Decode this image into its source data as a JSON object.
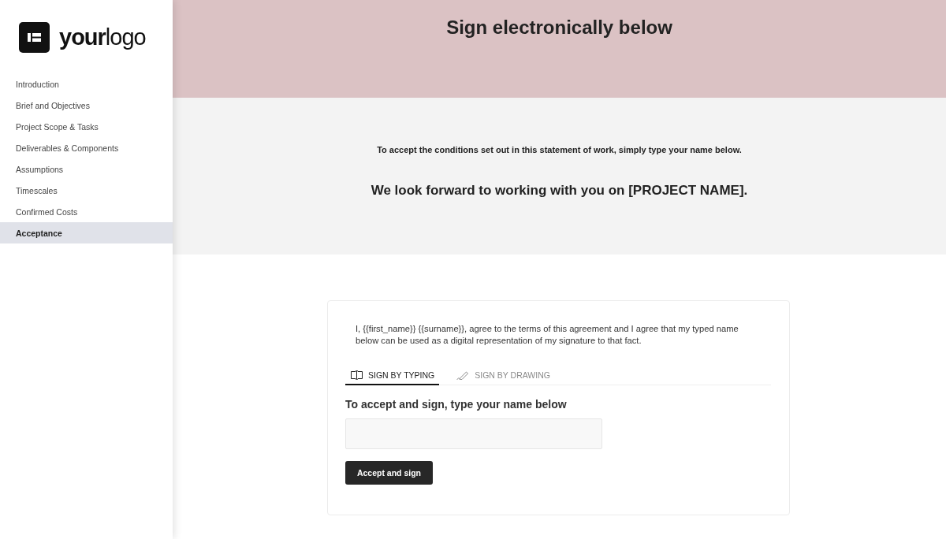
{
  "sidebar": {
    "logo": "**your**logo",
    "items": [
      {
        "label": "Introduction",
        "selected": false
      },
      {
        "label": "Brief and Objectives",
        "selected": false
      },
      {
        "label": "Project Scope & Tasks",
        "selected": false
      },
      {
        "label": "Deliverables & Components",
        "selected": false
      },
      {
        "label": "Assumptions",
        "selected": false
      },
      {
        "label": "Timescales",
        "selected": false
      },
      {
        "label": "Confirmed Costs",
        "selected": false
      },
      {
        "label": "Acceptance",
        "selected": true
      }
    ]
  },
  "header": {
    "title": "Sign electronically below"
  },
  "intro": {
    "instruction": "To accept the conditions set out in this statement of work, simply type your name below.",
    "message": "We look forward to working with you on [PROJECT NAME]."
  },
  "agreement": {
    "statement": "I, {{first_name}} {{surname}}, agree to the terms of this agreement and I agree that my typed name below can be used as a digital representation of my signature to that fact.",
    "tabs": [
      {
        "label": "SIGN BY TYPING",
        "selected": true,
        "kind": "typing"
      },
      {
        "label": "SIGN BY DRAWING",
        "selected": false,
        "kind": "drawing"
      }
    ],
    "prompt": "To accept and sign, type your name below",
    "button": "Accept and sign"
  }
}
